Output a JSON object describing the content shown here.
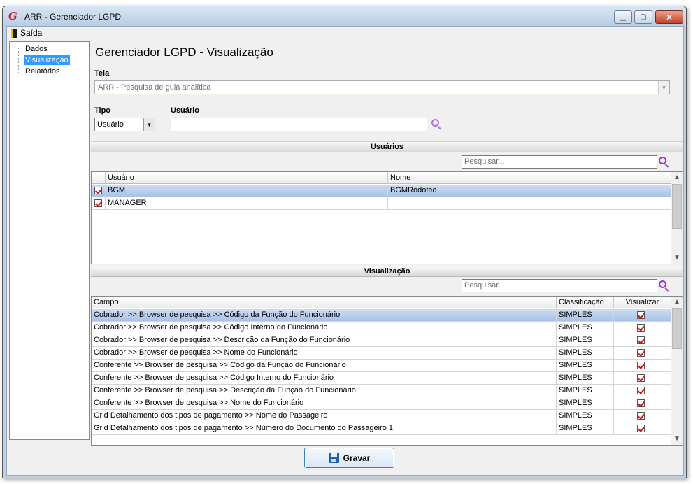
{
  "window": {
    "title": "ARR - Gerenciador LGPD",
    "app_icon_letter": "G",
    "min_glyph": "▁",
    "max_glyph": "▢",
    "close_glyph": "✕"
  },
  "menu": {
    "exit_label": "Saída"
  },
  "nav": {
    "items": [
      {
        "label": "Dados",
        "selected": false
      },
      {
        "label": "Visualização",
        "selected": true
      },
      {
        "label": "Relatórios",
        "selected": false
      }
    ]
  },
  "page": {
    "title": "Gerenciador LGPD - Visualização",
    "tela_label": "Tela",
    "tela_value": "ARR - Pesquisa de guia analítica",
    "tipo_label": "Tipo",
    "tipo_value": "Usuário",
    "usuario_label": "Usuário",
    "usuario_value": ""
  },
  "users_section": {
    "title": "Usuários",
    "search_placeholder": "Pesquisar...",
    "columns": [
      "Usuário",
      "Nome"
    ],
    "rows": [
      {
        "checked": true,
        "usuario": "BGM",
        "nome": "BGMRodotec",
        "selected": true
      },
      {
        "checked": true,
        "usuario": "MANAGER",
        "nome": "",
        "selected": false
      }
    ]
  },
  "view_section": {
    "title": "Visualização",
    "search_placeholder": "Pesquisar...",
    "columns": [
      "Campo",
      "Classificação",
      "Visualizar"
    ],
    "rows": [
      {
        "campo": "Cobrador >> Browser de pesquisa >> Código da Função do Funcionário",
        "classificacao": "SIMPLES",
        "visualizar": true,
        "selected": true
      },
      {
        "campo": "Cobrador >> Browser de pesquisa >> Código Interno do Funcionário",
        "classificacao": "SIMPLES",
        "visualizar": true,
        "selected": false
      },
      {
        "campo": "Cobrador >> Browser de pesquisa >> Descrição da Função do Funcionário",
        "classificacao": "SIMPLES",
        "visualizar": true,
        "selected": false
      },
      {
        "campo": "Cobrador >> Browser de pesquisa >> Nome do Funcionário",
        "classificacao": "SIMPLES",
        "visualizar": true,
        "selected": false
      },
      {
        "campo": "Conferente >> Browser de pesquisa >> Código da Função do Funcionário",
        "classificacao": "SIMPLES",
        "visualizar": true,
        "selected": false
      },
      {
        "campo": "Conferente >> Browser de pesquisa >> Código Interno do Funcionário",
        "classificacao": "SIMPLES",
        "visualizar": true,
        "selected": false
      },
      {
        "campo": "Conferente >> Browser de pesquisa >> Descrição da Função do Funcionário",
        "classificacao": "SIMPLES",
        "visualizar": true,
        "selected": false
      },
      {
        "campo": "Conferente >> Browser de pesquisa >> Nome do Funcionário",
        "classificacao": "SIMPLES",
        "visualizar": true,
        "selected": false
      },
      {
        "campo": "Grid Detalhamento dos tipos de pagamento >> Nome do Passageiro",
        "classificacao": "SIMPLES",
        "visualizar": true,
        "selected": false
      },
      {
        "campo": "Grid Detalhamento dos tipos de pagamento >> Número do Documento do Passageiro 1",
        "classificacao": "SIMPLES",
        "visualizar": true,
        "selected": false
      }
    ]
  },
  "footer": {
    "save_label_first": "G",
    "save_label_rest": "ravar"
  },
  "colors": {
    "accent": "#3399ff",
    "selected_row": "#a9c1e8",
    "search_icon": "#9b30d9",
    "check": "#d01010"
  }
}
